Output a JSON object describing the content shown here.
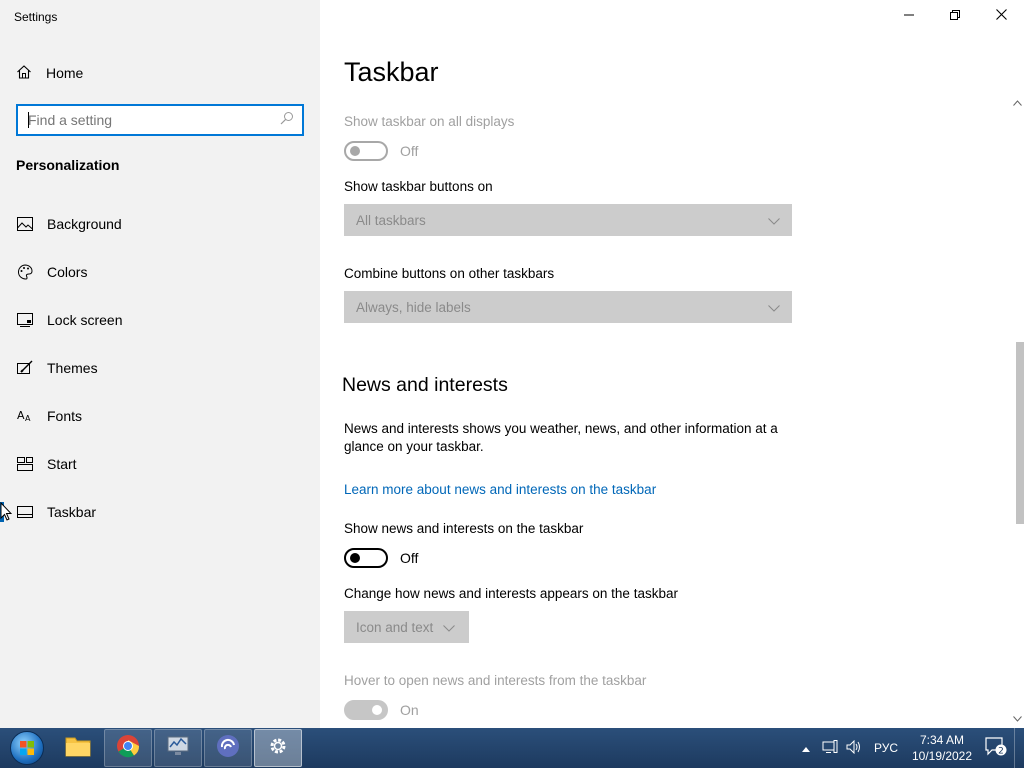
{
  "window": {
    "app_title": "Settings"
  },
  "sidebar": {
    "home_label": "Home",
    "search_placeholder": "Find a setting",
    "section_title": "Personalization",
    "items": [
      {
        "label": "Background",
        "icon": "picture-icon"
      },
      {
        "label": "Colors",
        "icon": "palette-icon"
      },
      {
        "label": "Lock screen",
        "icon": "lock-screen-icon"
      },
      {
        "label": "Themes",
        "icon": "themes-icon"
      },
      {
        "label": "Fonts",
        "icon": "fonts-icon"
      },
      {
        "label": "Start",
        "icon": "start-tiles-icon"
      },
      {
        "label": "Taskbar",
        "icon": "taskbar-icon",
        "active": true
      }
    ]
  },
  "content": {
    "page_title": "Taskbar",
    "show_all_displays": {
      "label": "Show taskbar on all displays",
      "state": "Off"
    },
    "show_buttons_on": {
      "label": "Show taskbar buttons on",
      "value": "All taskbars"
    },
    "combine_other": {
      "label": "Combine buttons on other taskbars",
      "value": "Always, hide labels"
    },
    "news_heading": "News and interests",
    "news_description": "News and interests shows you weather, news, and other information at a glance on your taskbar.",
    "news_link": "Learn more about news and interests on the taskbar",
    "show_news": {
      "label": "Show news and interests on the taskbar",
      "state": "Off"
    },
    "change_appearance": {
      "label": "Change how news and interests appears on the taskbar",
      "value": "Icon and text"
    },
    "hover_open": {
      "label": "Hover to open news and interests from the taskbar",
      "state": "On"
    }
  },
  "taskbar": {
    "start_label": "Start",
    "apps": [
      "file-explorer-icon",
      "chrome-icon",
      "network-monitor-icon",
      "bittorrent-icon",
      "settings-gear-icon"
    ],
    "language": "РУС",
    "time": "7:34 AM",
    "date": "10/19/2022",
    "notification_count": "2"
  },
  "colors": {
    "accent": "#0078d7",
    "link": "#0067b8",
    "sidebar_bg": "#f2f2f2",
    "disabled": "#a0a0a0"
  }
}
